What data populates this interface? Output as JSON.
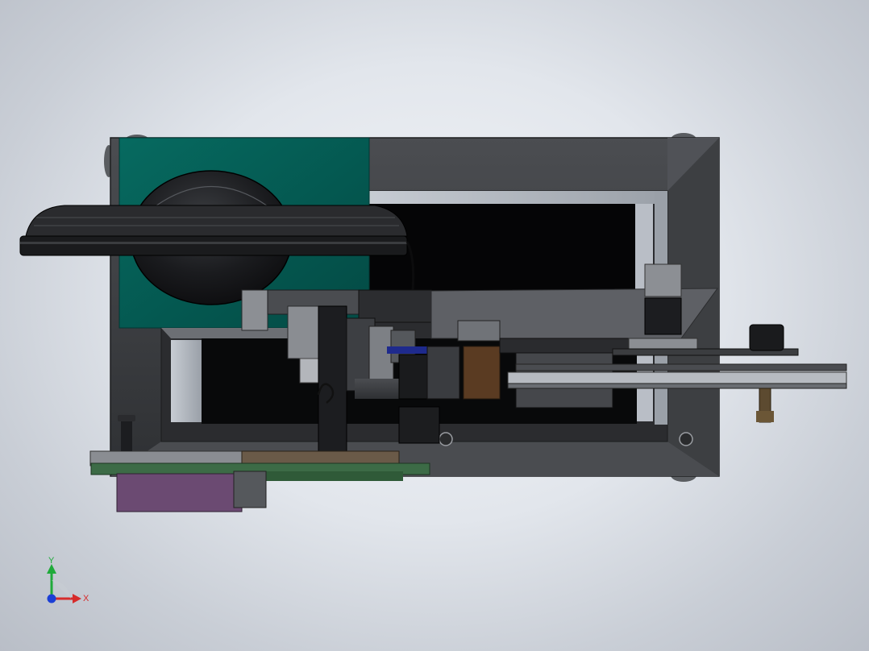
{
  "scene": {
    "background_top": "#f3f5f8",
    "background_bottom": "#b9bec7"
  },
  "colors": {
    "frame_dark": "#3b3d40",
    "frame_mid": "#595b5f",
    "frame_light": "#8a8d92",
    "teal_panel": "#045a52",
    "teal_dark": "#033e39",
    "black_part": "#111214",
    "purple_block": "#6b4a72",
    "green_plate": "#3c6b46",
    "rust_part": "#5a3b22",
    "blue_strip": "#1e2a8c",
    "gray_part": "#7c7f84"
  },
  "triad": {
    "x_label": "X",
    "y_label": "Y",
    "x_color": "#d62b2b",
    "y_color": "#1faa3a",
    "z_color": "#1b3fd6"
  }
}
